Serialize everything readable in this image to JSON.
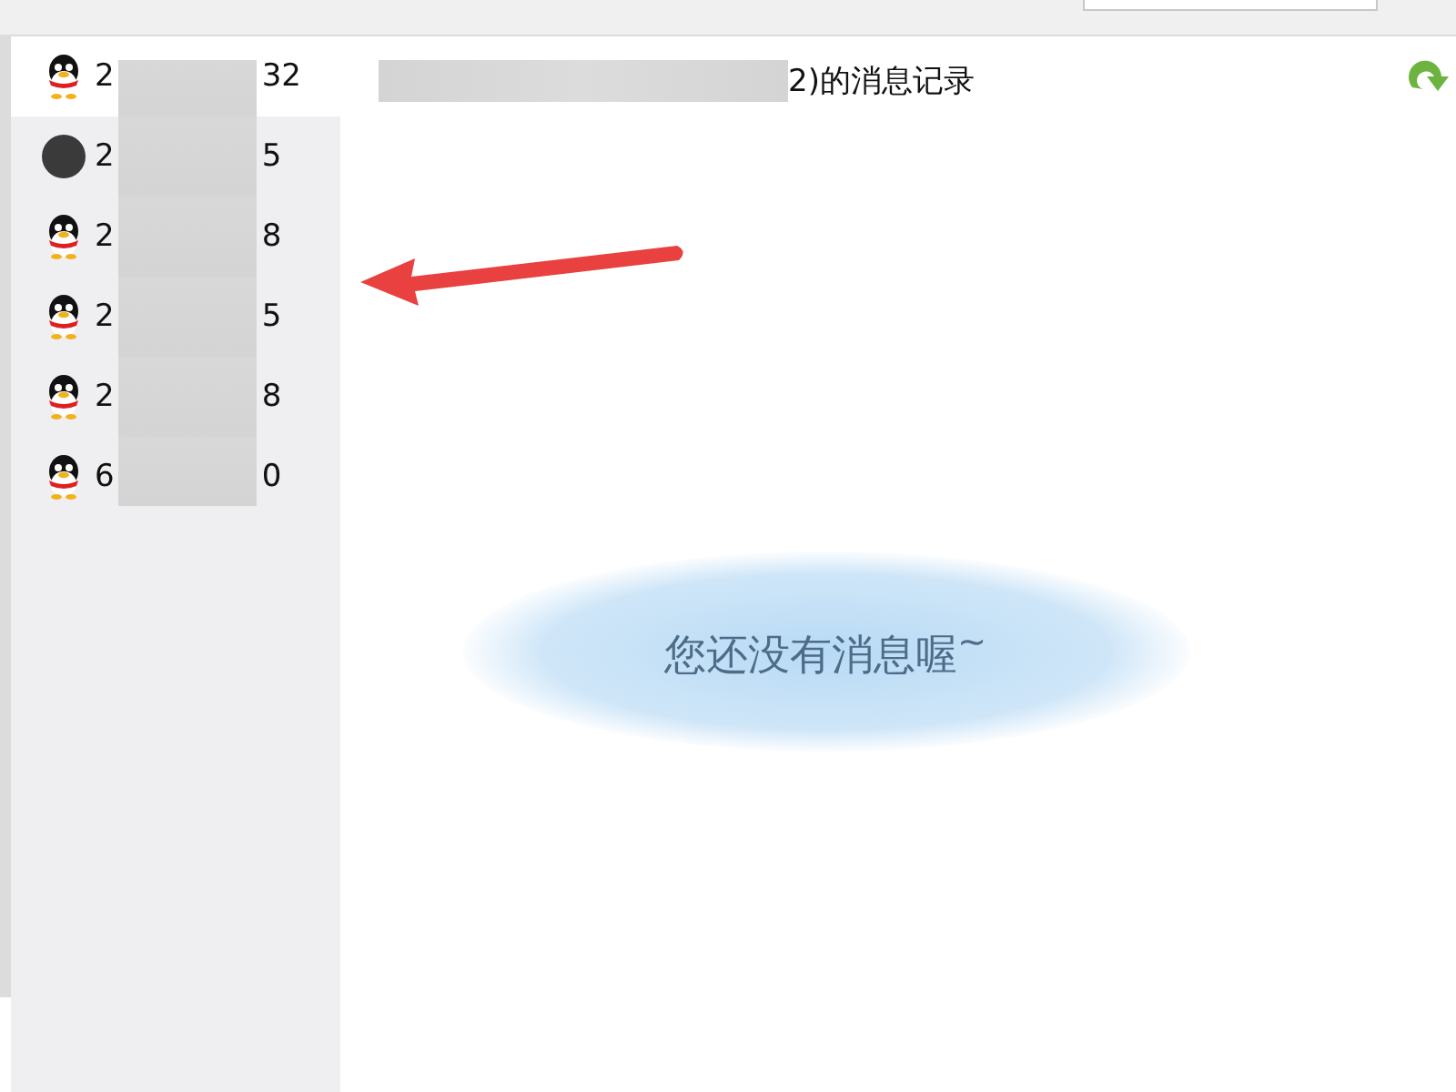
{
  "contacts": [
    {
      "label_start": "2",
      "label_end": "32",
      "kind": "penguin",
      "selected": true
    },
    {
      "label_start": "2",
      "label_end": "5",
      "kind": "photo",
      "selected": false
    },
    {
      "label_start": "2",
      "label_end": "8",
      "kind": "penguin",
      "selected": false
    },
    {
      "label_start": "2",
      "label_end": "5",
      "kind": "penguin",
      "selected": false
    },
    {
      "label_start": "2",
      "label_end": "8",
      "kind": "penguin",
      "selected": false
    },
    {
      "label_start": "6",
      "label_end": "0",
      "kind": "penguin",
      "selected": false
    }
  ],
  "header": {
    "title_end": "2)的消息记录"
  },
  "empty_message": "您还没有消息喔$^{~}$"
}
